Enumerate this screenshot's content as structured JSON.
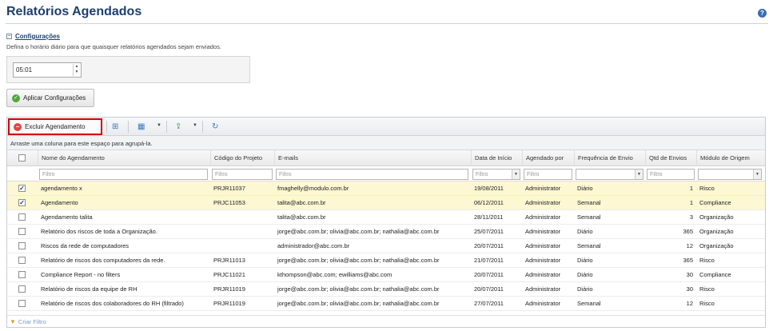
{
  "page": {
    "title": "Relatórios Agendados",
    "help_icon": "help-icon"
  },
  "config": {
    "toggle_label": "Configurações",
    "description": "Defina o horário diário para que quaisquer relatórios agendados sejam enviados.",
    "time_value": "05:01",
    "apply_label": "Aplicar Configurações"
  },
  "toolbar": {
    "delete_label": "Excluir Agendamento",
    "group_hint": "Arraste uma coluna para este espaço para agrupá-la."
  },
  "columns": {
    "name": "Nome do Agendamento",
    "project": "Código do Projeto",
    "emails": "E-mails",
    "start": "Data de Início",
    "by": "Agendado por",
    "freq": "Frequência de Envio",
    "count": "Qtd de Envios",
    "module": "Módulo de Origem"
  },
  "filter_placeholder": "Filtro",
  "rows": [
    {
      "checked": true,
      "name": "agendamento x",
      "project": "PRJR11037",
      "emails": "fmaghelly@modulo.com.br",
      "start": "19/08/2011",
      "by": "Administrator",
      "freq": "Diário",
      "count": "1",
      "module": "Risco"
    },
    {
      "checked": true,
      "name": "Agendamento",
      "project": "PRJC11053",
      "emails": "talita@abc.com.br",
      "start": "06/12/2011",
      "by": "Administrator",
      "freq": "Semanal",
      "count": "1",
      "module": "Compliance"
    },
    {
      "checked": false,
      "name": "Agendamento talita",
      "project": "",
      "emails": "talita@abc.com.br",
      "start": "28/11/2011",
      "by": "Administrator",
      "freq": "Semanal",
      "count": "3",
      "module": "Organização"
    },
    {
      "checked": false,
      "name": "Relatório dos riscos de toda a Organização.",
      "project": "",
      "emails": "jorge@abc.com.br; olivia@abc.com.br; nathalia@abc.com.br",
      "start": "25/07/2011",
      "by": "Administrator",
      "freq": "Diário",
      "count": "365",
      "module": "Organização"
    },
    {
      "checked": false,
      "name": "Riscos da rede de computadores",
      "project": "",
      "emails": "administrador@abc.com.br",
      "start": "20/07/2011",
      "by": "Administrator",
      "freq": "Semanal",
      "count": "12",
      "module": "Organização"
    },
    {
      "checked": false,
      "name": "Relatório de riscos dos computadores da rede.",
      "project": "PRJR11013",
      "emails": "jorge@abc.com.br; olivia@abc.com.br; nathalia@abc.com.br",
      "start": "21/07/2011",
      "by": "Administrator",
      "freq": "Diário",
      "count": "365",
      "module": "Risco"
    },
    {
      "checked": false,
      "name": "Compliance Report - no filters",
      "project": "PRJC11021",
      "emails": "kthompson@abc.com; ewilliams@abc.com",
      "start": "20/07/2011",
      "by": "Administrator",
      "freq": "Diário",
      "count": "30",
      "module": "Compliance"
    },
    {
      "checked": false,
      "name": "Relatório de riscos da equipe de RH",
      "project": "PRJR11019",
      "emails": "jorge@abc.com.br; olivia@abc.com.br; nathalia@abc.com.br",
      "start": "20/07/2011",
      "by": "Administrator",
      "freq": "Diário",
      "count": "30",
      "module": "Risco"
    },
    {
      "checked": false,
      "name": "Relatório de riscos dos colaboradores do RH (filtrado)",
      "project": "PRJR11019",
      "emails": "jorge@abc.com.br; olivia@abc.com.br; nathalia@abc.com.br",
      "start": "27/07/2011",
      "by": "Administrator",
      "freq": "Semanal",
      "count": "12",
      "module": "Risco"
    }
  ],
  "footer": {
    "create_filter": "Criar Filtro"
  },
  "colors": {
    "title": "#1d3f6e",
    "selected_row": "#fdf7d3",
    "delete_outline": "#d40000"
  }
}
